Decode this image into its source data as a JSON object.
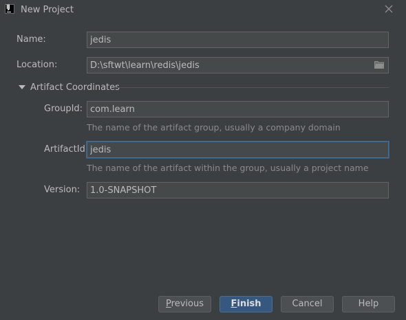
{
  "window": {
    "title": "New Project",
    "app_icon_text": "IJ"
  },
  "form": {
    "name_label": "Name:",
    "name_value": "jedis",
    "location_label": "Location:",
    "location_value": "D:\\sftwt\\learn\\redis\\jedis"
  },
  "artifact": {
    "section_title": "Artifact Coordinates",
    "groupid_label": "GroupId:",
    "groupid_value": "com.learn",
    "groupid_hint": "The name of the artifact group, usually a company domain",
    "artifactid_label": "ArtifactId:",
    "artifactid_value": "jedis",
    "artifactid_hint": "The name of the artifact within the group, usually a project name",
    "version_label": "Version:",
    "version_value": "1.0-SNAPSHOT"
  },
  "buttons": {
    "previous": {
      "mnemonic": "P",
      "rest": "revious"
    },
    "finish": {
      "mnemonic": "F",
      "rest": "inish"
    },
    "cancel": "Cancel",
    "help": "Help"
  },
  "colors": {
    "background": "#3c3f41",
    "field_bg": "#45494a",
    "field_border": "#646464",
    "focus_border": "#466d94",
    "default_button": "#365880",
    "text": "#bbbbbb",
    "hint_text": "#8a8a8a"
  }
}
